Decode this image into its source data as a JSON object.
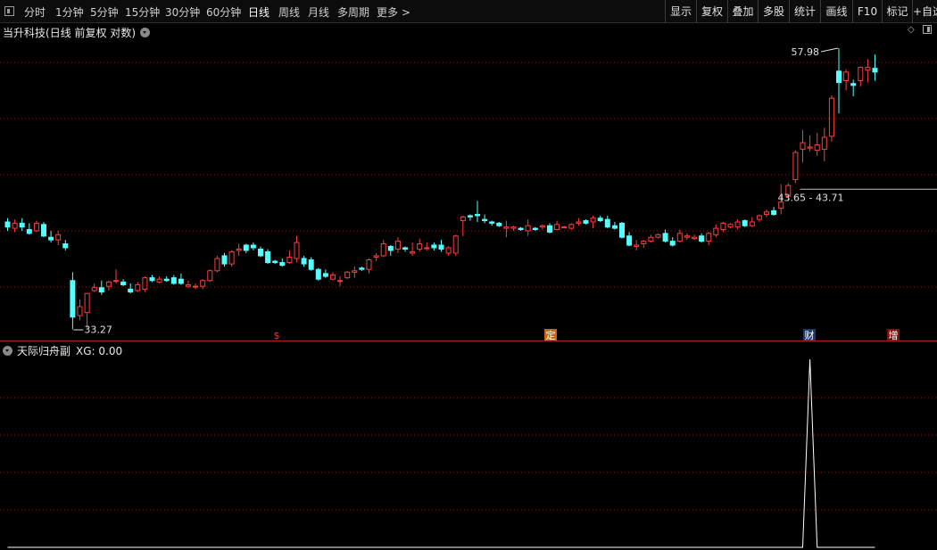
{
  "toolbar": {
    "periods": [
      "分时",
      "1分钟",
      "5分钟",
      "15分钟",
      "30分钟",
      "60分钟",
      "日线",
      "周线",
      "月线",
      "多周期",
      "更多 >"
    ],
    "active_period": "日线",
    "right_buttons": [
      "显示",
      "复权",
      "叠加",
      "多股",
      "统计",
      "画线",
      "F10",
      "标记",
      "+自选"
    ]
  },
  "main_chart": {
    "stock_name": "当升科技",
    "descriptor": "(日线 前复权 对数)",
    "high_label": "57.98",
    "low_label": "33.27",
    "range_label": "43.65 - 43.71",
    "markers": [
      "$",
      "定",
      "财",
      "增"
    ]
  },
  "indicator": {
    "name": "天际归舟副",
    "value_text": "XG: 0.00"
  },
  "colors": {
    "up": "#ff3c3c",
    "down": "#54ffff",
    "grid": "#8b1818",
    "divider": "#a31a1a",
    "text": "#e0e0e0"
  },
  "chart_data": {
    "type": "candlestick",
    "price_scale": "log",
    "candles": [
      [
        41.0,
        41.3,
        40.3,
        40.6
      ],
      [
        40.5,
        41.2,
        40.2,
        40.9
      ],
      [
        40.9,
        41.3,
        40.3,
        40.6
      ],
      [
        40.4,
        40.9,
        40.0,
        40.1
      ],
      [
        40.3,
        41.1,
        40.2,
        40.9
      ],
      [
        40.8,
        41.0,
        39.8,
        39.9
      ],
      [
        39.8,
        40.3,
        39.4,
        39.6
      ],
      [
        39.6,
        40.3,
        39.2,
        40.0
      ],
      [
        39.3,
        39.6,
        38.8,
        39.0
      ],
      [
        36.6,
        37.2,
        33.3,
        34.1
      ],
      [
        34.2,
        35.3,
        33.9,
        34.8
      ],
      [
        34.4,
        35.7,
        33.4,
        35.7
      ],
      [
        35.9,
        36.4,
        35.8,
        36.1
      ],
      [
        36.1,
        36.6,
        35.6,
        35.8
      ],
      [
        36.2,
        36.6,
        35.9,
        36.5
      ],
      [
        36.6,
        37.4,
        36.4,
        36.6
      ],
      [
        36.5,
        36.7,
        36.2,
        36.3
      ],
      [
        36.0,
        36.4,
        35.7,
        35.8
      ],
      [
        35.9,
        36.5,
        35.8,
        36.3
      ],
      [
        36.0,
        36.9,
        35.8,
        36.8
      ],
      [
        36.8,
        37.0,
        36.5,
        36.6
      ],
      [
        36.5,
        36.9,
        36.4,
        36.7
      ],
      [
        36.7,
        36.9,
        36.5,
        36.6
      ],
      [
        36.8,
        37.0,
        36.3,
        36.4
      ],
      [
        36.7,
        37.1,
        36.3,
        36.4
      ],
      [
        36.2,
        36.6,
        36.1,
        36.3
      ],
      [
        36.2,
        36.4,
        36.0,
        36.2
      ],
      [
        36.2,
        36.7,
        36.0,
        36.6
      ],
      [
        36.6,
        37.4,
        36.5,
        37.3
      ],
      [
        37.3,
        38.4,
        37.2,
        38.2
      ],
      [
        38.4,
        38.6,
        37.6,
        37.8
      ],
      [
        37.8,
        38.8,
        37.6,
        38.7
      ],
      [
        38.8,
        39.3,
        38.4,
        38.9
      ],
      [
        39.2,
        39.3,
        38.6,
        38.8
      ],
      [
        39.2,
        39.4,
        38.8,
        39.0
      ],
      [
        38.9,
        39.1,
        38.3,
        38.4
      ],
      [
        38.7,
        38.9,
        37.8,
        37.9
      ],
      [
        38.0,
        38.1,
        37.8,
        37.9
      ],
      [
        37.9,
        38.2,
        37.6,
        37.7
      ],
      [
        37.9,
        38.8,
        37.8,
        38.3
      ],
      [
        38.2,
        39.9,
        37.9,
        39.4
      ],
      [
        38.2,
        38.4,
        37.6,
        37.8
      ],
      [
        38.1,
        38.3,
        37.3,
        37.4
      ],
      [
        37.4,
        37.5,
        36.6,
        36.7
      ],
      [
        37.1,
        37.4,
        36.8,
        36.9
      ],
      [
        36.7,
        37.2,
        36.6,
        37.0
      ],
      [
        36.6,
        36.9,
        36.2,
        36.6
      ],
      [
        36.8,
        37.3,
        36.7,
        37.2
      ],
      [
        37.2,
        37.6,
        36.8,
        37.3
      ],
      [
        37.5,
        37.6,
        37.3,
        37.4
      ],
      [
        37.4,
        38.2,
        37.1,
        38.1
      ],
      [
        38.3,
        38.6,
        38.0,
        38.4
      ],
      [
        38.4,
        39.6,
        38.3,
        39.3
      ],
      [
        39.1,
        39.2,
        38.4,
        38.8
      ],
      [
        38.9,
        39.8,
        38.6,
        39.5
      ],
      [
        39.0,
        39.1,
        38.7,
        38.9
      ],
      [
        38.6,
        39.4,
        38.4,
        38.7
      ],
      [
        38.9,
        39.7,
        38.7,
        39.3
      ],
      [
        39.0,
        39.4,
        38.8,
        39.0
      ],
      [
        39.2,
        39.4,
        38.8,
        39.0
      ],
      [
        39.2,
        39.6,
        38.7,
        38.9
      ],
      [
        38.6,
        39.1,
        38.4,
        39.0
      ],
      [
        38.6,
        40.0,
        38.4,
        39.9
      ],
      [
        41.1,
        41.5,
        39.9,
        41.4
      ],
      [
        41.5,
        41.6,
        41.1,
        41.4
      ],
      [
        41.6,
        42.7,
        41.0,
        41.5
      ],
      [
        41.2,
        41.6,
        40.9,
        41.1
      ],
      [
        41.0,
        41.1,
        40.7,
        40.9
      ],
      [
        40.9,
        41.0,
        40.6,
        40.7
      ],
      [
        40.5,
        41.1,
        39.8,
        40.6
      ],
      [
        40.5,
        40.7,
        40.3,
        40.6
      ],
      [
        40.5,
        40.6,
        40.3,
        40.4
      ],
      [
        40.3,
        41.2,
        39.9,
        40.7
      ],
      [
        40.5,
        40.6,
        40.3,
        40.4
      ],
      [
        40.6,
        40.8,
        40.4,
        40.7
      ],
      [
        40.7,
        40.9,
        40.1,
        40.2
      ],
      [
        40.4,
        41.1,
        40.4,
        40.8
      ],
      [
        40.6,
        40.7,
        40.5,
        40.6
      ],
      [
        40.5,
        40.9,
        40.4,
        40.8
      ],
      [
        40.9,
        41.3,
        40.7,
        41.0
      ],
      [
        41.1,
        41.2,
        40.8,
        40.9
      ],
      [
        41.0,
        41.5,
        40.5,
        41.3
      ],
      [
        41.3,
        41.5,
        41.0,
        41.1
      ],
      [
        41.2,
        41.5,
        40.5,
        40.6
      ],
      [
        40.7,
        41.0,
        40.4,
        40.5
      ],
      [
        40.9,
        41.0,
        39.7,
        39.8
      ],
      [
        39.9,
        40.2,
        39.1,
        39.2
      ],
      [
        39.1,
        39.6,
        38.8,
        39.2
      ],
      [
        39.3,
        39.6,
        39.0,
        39.5
      ],
      [
        39.5,
        40.0,
        39.4,
        39.8
      ],
      [
        39.8,
        40.1,
        39.7,
        40.0
      ],
      [
        40.1,
        40.4,
        39.4,
        39.5
      ],
      [
        39.5,
        39.8,
        39.1,
        39.2
      ],
      [
        39.5,
        40.4,
        39.4,
        40.1
      ],
      [
        39.8,
        40.1,
        39.6,
        39.9
      ],
      [
        39.7,
        40.0,
        39.6,
        39.8
      ],
      [
        39.9,
        40.1,
        39.4,
        39.5
      ],
      [
        39.5,
        40.2,
        39.2,
        40.1
      ],
      [
        40.0,
        40.8,
        39.8,
        40.5
      ],
      [
        40.4,
        41.0,
        40.2,
        40.9
      ],
      [
        40.6,
        40.9,
        40.5,
        40.8
      ],
      [
        40.6,
        41.2,
        40.4,
        41.0
      ],
      [
        41.1,
        41.2,
        40.6,
        40.7
      ],
      [
        40.7,
        41.4,
        40.6,
        41.0
      ],
      [
        41.2,
        41.6,
        41.0,
        41.5
      ],
      [
        41.6,
        42.0,
        41.4,
        41.8
      ],
      [
        41.9,
        42.2,
        41.5,
        41.6
      ],
      [
        42.1,
        44.1,
        41.6,
        42.6
      ],
      [
        43.1,
        44.2,
        42.7,
        44.0
      ],
      [
        44.5,
        47.1,
        44.2,
        46.9
      ],
      [
        47.2,
        49.0,
        46.0,
        47.8
      ],
      [
        47.3,
        48.5,
        47.0,
        47.4
      ],
      [
        47.1,
        48.7,
        46.6,
        47.6
      ],
      [
        47.2,
        49.2,
        46.1,
        48.3
      ],
      [
        48.4,
        52.4,
        47.9,
        52.1
      ],
      [
        54.9,
        57.4,
        50.6,
        53.7
      ],
      [
        53.9,
        55.1,
        52.9,
        54.8
      ],
      [
        53.6,
        54.0,
        52.3,
        53.4
      ],
      [
        53.9,
        55.4,
        53.3,
        55.3
      ],
      [
        55.0,
        56.2,
        53.7,
        55.3
      ],
      [
        55.2,
        56.7,
        53.9,
        54.8
      ]
    ],
    "xg_signal_index": 111,
    "xg_peak_value": 1.0
  }
}
